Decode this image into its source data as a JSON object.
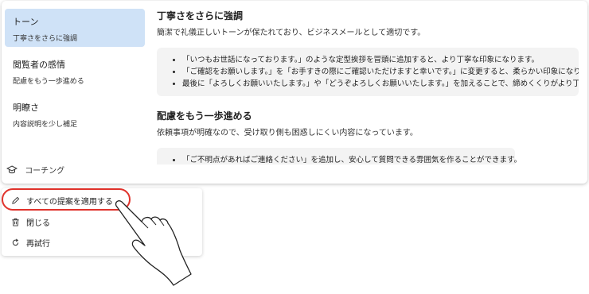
{
  "sidebar": {
    "items": [
      {
        "title": "トーン",
        "subtitle": "丁寧さをさらに強調"
      },
      {
        "title": "閲覧者の感情",
        "subtitle": "配慮をもう一歩進める"
      },
      {
        "title": "明瞭さ",
        "subtitle": "内容説明を少し補足"
      }
    ]
  },
  "sections": [
    {
      "title": "丁寧さをさらに強調",
      "description": "簡潔で礼儀正しいトーンが保たれており、ビジネスメールとして適切です。",
      "bullets": [
        "「いつもお世話になっております。」のような定型挨拶を冒頭に追加すると、より丁寧な印象になります。",
        "「ご確認をお願いします。」を「お手すきの際にご確認いただけますと幸いです。」に変更すると、柔らかい印象になります。",
        "最後に「よろしくお願いいたします。」や「どうぞよろしくお願いいたします。」を加えることで、締めくくりがより丁寧になります。"
      ]
    },
    {
      "title": "配慮をもう一歩進める",
      "description": "依頼事項が明確なので、受け取り側も困惑しにくい内容になっています。",
      "bullets": [
        "「ご不明点があればご連絡ください」を追加し、安心して質問できる雰囲気を作ることができます。"
      ]
    }
  ],
  "coaching": {
    "label": "コーチング",
    "icon": "coaching-icon"
  },
  "menu": {
    "items": [
      {
        "label": "すべての提案を適用する",
        "icon": "pencil-icon"
      },
      {
        "label": "閉じる",
        "icon": "trash-icon"
      },
      {
        "label": "再試行",
        "icon": "retry-icon"
      }
    ]
  },
  "colors": {
    "accent": "#cfe2f7",
    "highlight": "#e0322b"
  }
}
